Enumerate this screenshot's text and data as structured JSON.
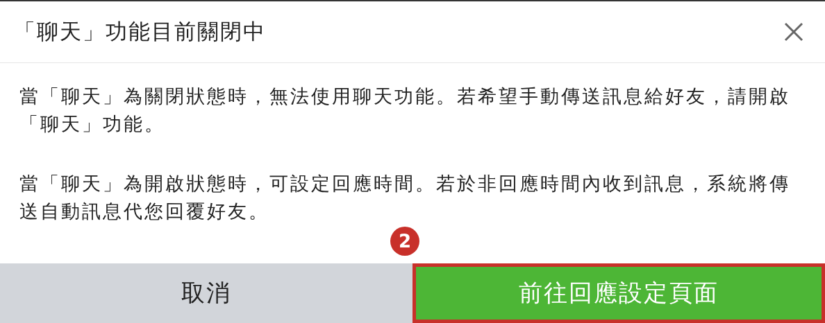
{
  "dialog": {
    "title": "「聊天」功能目前關閉中",
    "paragraphs": [
      "當「聊天」為關閉狀態時，無法使用聊天功能。若希望手動傳送訊息給好友，請開啟「聊天」功能。",
      "當「聊天」為開啟狀態時，可設定回應時間。若於非回應時間內收到訊息，系統將傳送自動訊息代您回覆好友。"
    ],
    "buttons": [
      {
        "label": "取消",
        "kind": "cancel",
        "highlighted": false
      },
      {
        "label": "前往回應設定頁面",
        "kind": "primary",
        "highlighted": true
      }
    ]
  },
  "annotation": {
    "label": "2"
  }
}
